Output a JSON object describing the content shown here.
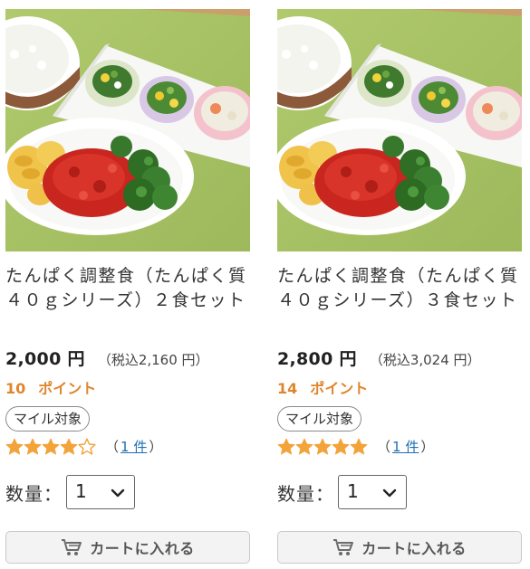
{
  "products": [
    {
      "image_alt": "たんぱく調整食 2食セット 料理写真",
      "title": "たんぱく調整食（たんぱく質４０ｇシリーズ）２食セット",
      "price": "2,000 円",
      "tax_included": "（税込2,160 円）",
      "points_value": "10",
      "points_label": "ポイント",
      "mile_badge": "マイル対象",
      "rating": 4,
      "rating_max": 5,
      "review_open": "（",
      "review_count": "1 件",
      "review_close": "）",
      "qty_label": "数量：",
      "qty_value": "1",
      "cart_label": "カートに入れる"
    },
    {
      "image_alt": "たんぱく調整食 3食セット 料理写真",
      "title": "たんぱく調整食（たんぱく質４０ｇシリーズ）３食セット",
      "price": "2,800 円",
      "tax_included": "（税込3,024 円）",
      "points_value": "14",
      "points_label": "ポイント",
      "mile_badge": "マイル対象",
      "rating": 5,
      "rating_max": 5,
      "review_open": "（",
      "review_count": "1 件",
      "review_close": "）",
      "qty_label": "数量：",
      "qty_value": "1",
      "cart_label": "カートに入れる"
    }
  ],
  "colors": {
    "points": "#e0852c",
    "star_filled": "#f2a33a",
    "star_empty": "#f2a33a",
    "link": "#1f6fb2",
    "placemat": "#a9c467"
  },
  "icons": {
    "cart": "cart-icon",
    "star": "star-icon",
    "chevron": "chevron-down-icon"
  }
}
